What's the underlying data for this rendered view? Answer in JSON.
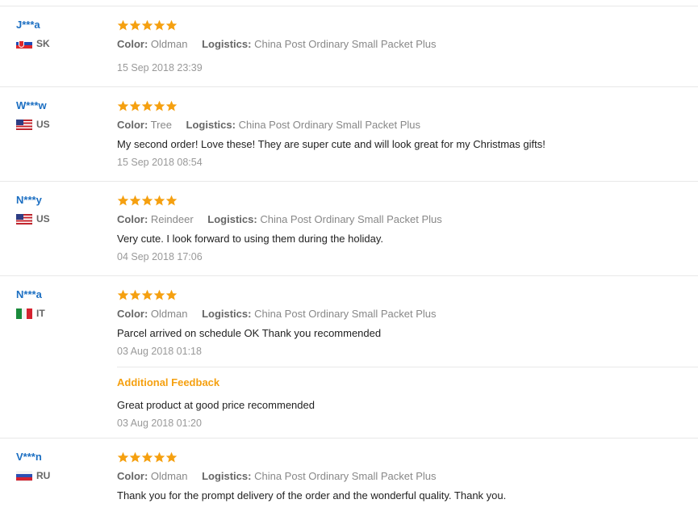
{
  "colors": {
    "star": "#f5a010",
    "username": "#1c6fc2",
    "additional_title": "#f5a010"
  },
  "labels": {
    "color": "Color:",
    "logistics": "Logistics:",
    "additional_feedback": "Additional Feedback"
  },
  "reviews": [
    {
      "user": "J***a",
      "country": "SK",
      "rating": 5,
      "color": "Oldman",
      "logistics": "China Post Ordinary Small Packet Plus",
      "text": "",
      "date": "15 Sep 2018 23:39"
    },
    {
      "user": "W***w",
      "country": "US",
      "rating": 5,
      "color": "Tree",
      "logistics": "China Post Ordinary Small Packet Plus",
      "text": "My second order! Love these! They are super cute and will look great for my Christmas gifts!",
      "date": "15 Sep 2018 08:54"
    },
    {
      "user": "N***y",
      "country": "US",
      "rating": 5,
      "color": "Reindeer",
      "logistics": "China Post Ordinary Small Packet Plus",
      "text": "Very cute. I look forward to using them during the holiday.",
      "date": "04 Sep 2018 17:06"
    },
    {
      "user": "N***a",
      "country": "IT",
      "rating": 5,
      "color": "Oldman",
      "logistics": "China Post Ordinary Small Packet Plus",
      "text": "Parcel arrived on schedule OK Thank you recommended",
      "date": "03 Aug 2018 01:18",
      "additional": {
        "text": "Great product at good price recommended",
        "date": "03 Aug 2018 01:20"
      }
    },
    {
      "user": "V***n",
      "country": "RU",
      "rating": 5,
      "color": "Oldman",
      "logistics": "China Post Ordinary Small Packet Plus",
      "text": "Thank you for the prompt delivery of the order and the wonderful quality. Thank you.",
      "date": ""
    }
  ]
}
